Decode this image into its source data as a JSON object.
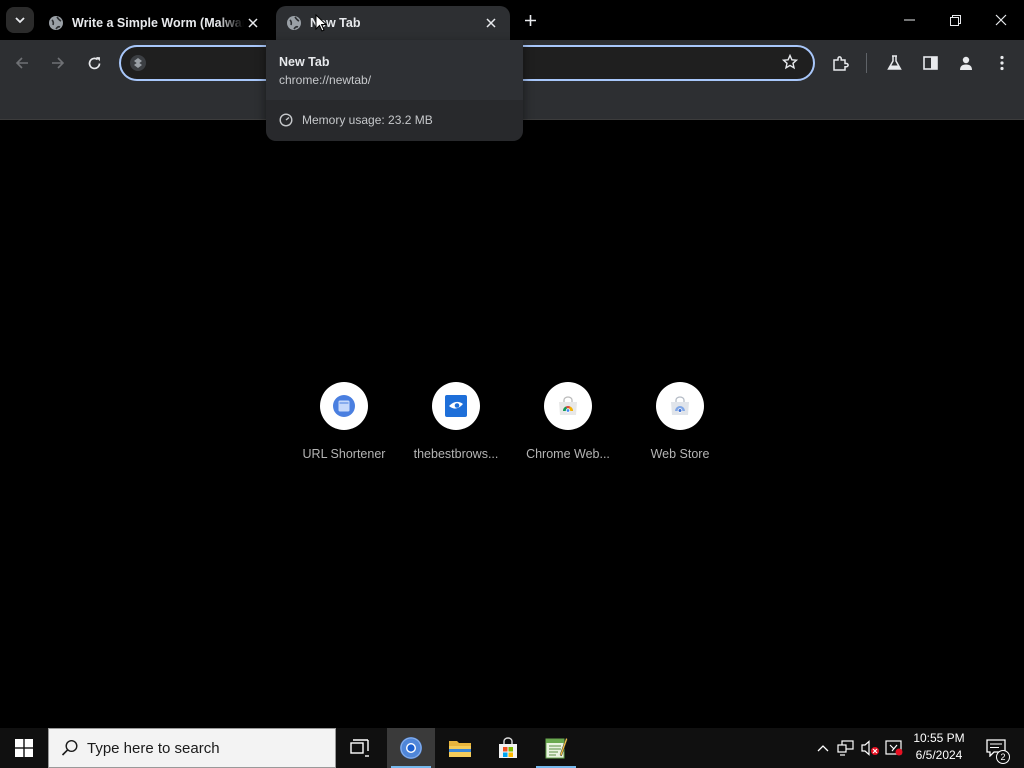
{
  "browser": {
    "tabs": [
      {
        "title": "Write a Simple Worm (Malware",
        "favicon": "globe-icon",
        "active": false
      },
      {
        "title": "New Tab",
        "favicon": "globe-icon",
        "active": true
      }
    ],
    "omnibox": {
      "value": "",
      "placeholder": ""
    },
    "hover_card": {
      "title": "New Tab",
      "url": "chrome://newtab/",
      "memory": "Memory usage: 23.2 MB"
    },
    "shortcuts": [
      {
        "label": "URL Shortener",
        "icon": "url-shortener-icon"
      },
      {
        "label": "thebestbrows...",
        "icon": "thebestbrowser-icon"
      },
      {
        "label": "Chrome Web...",
        "icon": "chrome-web-store-icon"
      },
      {
        "label": "Web Store",
        "icon": "web-store-icon"
      }
    ],
    "accent": "#a8c7fa"
  },
  "taskbar": {
    "search_placeholder": "Type here to search",
    "apps": [
      "task-view-icon",
      "chrome-icon",
      "file-explorer-icon",
      "microsoft-store-icon",
      "notepad-icon"
    ],
    "clock": {
      "time": "10:55 PM",
      "date": "6/5/2024"
    },
    "notifications": "2"
  }
}
